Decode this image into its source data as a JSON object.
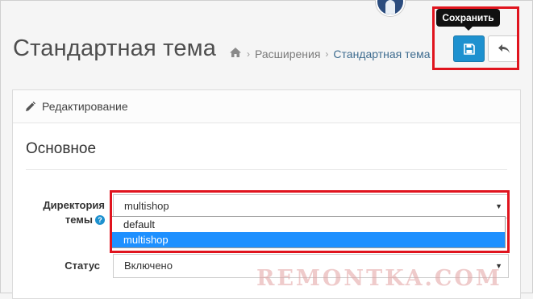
{
  "header": {
    "title": "Стандартная тема",
    "breadcrumb": [
      {
        "label": "Расширения"
      },
      {
        "label": "Стандартная тема"
      }
    ]
  },
  "toolbar": {
    "save_tooltip": "Сохранить",
    "save_icon": "floppy-disk-icon",
    "back_icon": "reply-arrow-icon"
  },
  "panel": {
    "heading": "Редактирование",
    "heading_icon": "pencil-icon",
    "section_title": "Основное"
  },
  "form": {
    "directory": {
      "label": "Директория темы",
      "value": "multishop",
      "options": [
        {
          "label": "default",
          "selected": false
        },
        {
          "label": "multishop",
          "selected": true
        }
      ]
    },
    "status": {
      "label": "Статус",
      "value": "Включено"
    }
  },
  "watermark": "REMONTKA.COM",
  "colors": {
    "accent": "#1e91cf",
    "highlight": "#e0141e",
    "selected_option": "#1e90ff"
  }
}
